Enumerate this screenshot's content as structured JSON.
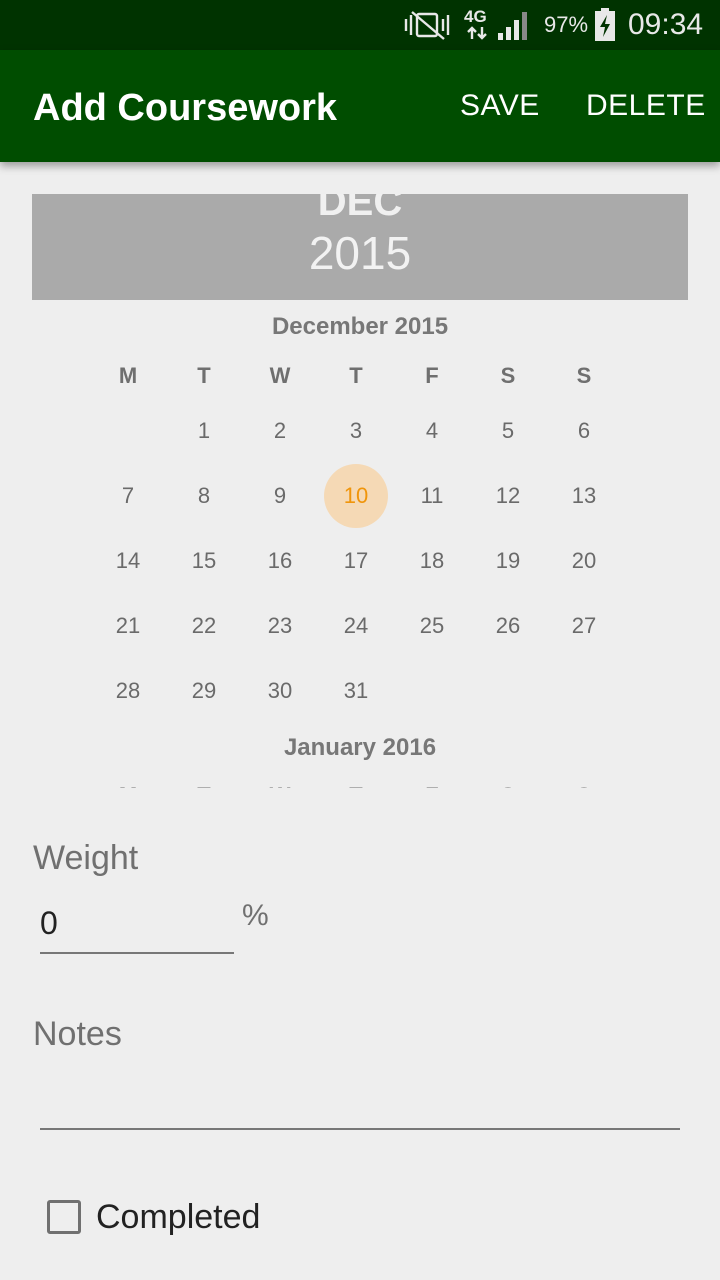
{
  "status_bar": {
    "network": "4G",
    "battery": "97%",
    "time": "09:34",
    "icons": [
      "mute-icon",
      "data-arrows-icon",
      "signal-icon",
      "battery-charging-icon"
    ]
  },
  "app_bar": {
    "title": "Add Coursework",
    "save_label": "SAVE",
    "delete_label": "DELETE"
  },
  "date_picker": {
    "header_month": "DEC",
    "header_year": "2015",
    "month_title": "December 2015",
    "next_month_title": "January 2016",
    "weekdays": [
      "M",
      "T",
      "W",
      "T",
      "F",
      "S",
      "S"
    ],
    "weeks": [
      [
        "",
        "1",
        "2",
        "3",
        "4",
        "5",
        "6"
      ],
      [
        "7",
        "8",
        "9",
        "10",
        "11",
        "12",
        "13"
      ],
      [
        "14",
        "15",
        "16",
        "17",
        "18",
        "19",
        "20"
      ],
      [
        "21",
        "22",
        "23",
        "24",
        "25",
        "26",
        "27"
      ],
      [
        "28",
        "29",
        "30",
        "31",
        "",
        "",
        ""
      ]
    ],
    "selected_day": "10",
    "selected_color": "#f0950a"
  },
  "weight": {
    "label": "Weight",
    "value": "0",
    "unit": "%"
  },
  "notes": {
    "label": "Notes",
    "value": ""
  },
  "completed": {
    "label": "Completed",
    "checked": false
  },
  "colors": {
    "status_bar": "#003300",
    "app_bar": "#004d00",
    "picker_header": "#aaaaaa",
    "background": "#eeeeee"
  }
}
